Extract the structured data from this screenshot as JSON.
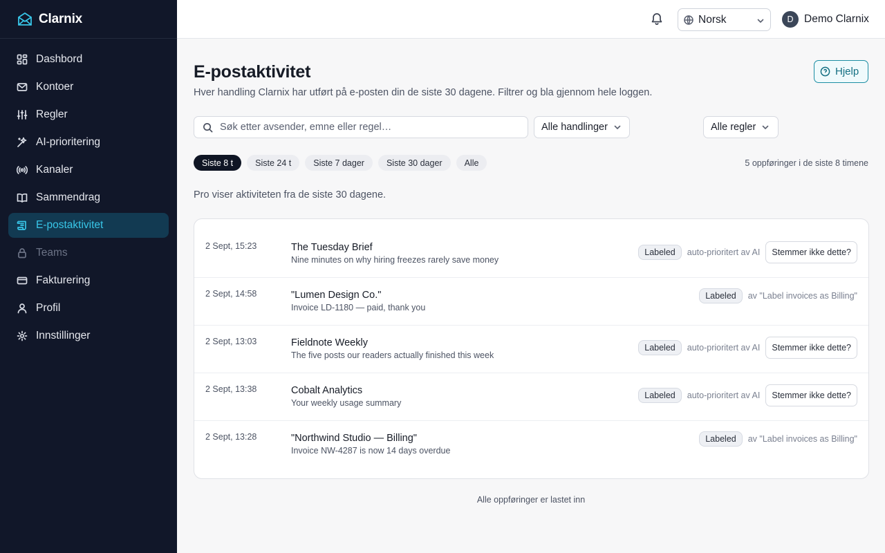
{
  "app": {
    "name": "Clarnix"
  },
  "sidebar": {
    "items": [
      {
        "label": "Dashbord",
        "icon": "grid-icon"
      },
      {
        "label": "Kontoer",
        "icon": "mail-icon"
      },
      {
        "label": "Regler",
        "icon": "sliders-icon"
      },
      {
        "label": "AI-prioritering",
        "icon": "sparkle-icon"
      },
      {
        "label": "Kanaler",
        "icon": "broadcast-icon"
      },
      {
        "label": "Sammendrag",
        "icon": "book-icon"
      },
      {
        "label": "E-postaktivitet",
        "icon": "scroll-icon",
        "active": true
      },
      {
        "label": "Teams",
        "icon": "lock-icon",
        "disabled": true
      },
      {
        "label": "Fakturering",
        "icon": "card-icon"
      },
      {
        "label": "Profil",
        "icon": "user-icon"
      },
      {
        "label": "Innstillinger",
        "icon": "gear-icon"
      }
    ]
  },
  "topbar": {
    "language": "Norsk",
    "user_initial": "D",
    "user_name": "Demo Clarnix"
  },
  "page": {
    "title": "E-postaktivitet",
    "subtitle": "Hver handling Clarnix har utført på e-posten din de siste 30 dagene. Filtrer og bla gjennom hele loggen.",
    "help_label": "Hjelp",
    "search_placeholder": "Søk etter avsender, emne eller regel…",
    "actions_filter": "Alle handlinger",
    "rules_filter": "Alle regler",
    "time_chips": [
      "Siste 8 t",
      "Siste 24 t",
      "Siste 7 dager",
      "Siste 30 dager",
      "Alle"
    ],
    "active_chip": 0,
    "entries_count": "5 oppføringer i de siste 8 timene",
    "pro_note": "Pro viser aktiviteten fra de siste 30 dagene.",
    "all_loaded": "Alle oppføringer er lastet inn"
  },
  "log": [
    {
      "time": "2 Sept, 15:23",
      "sender": "The Tuesday Brief",
      "subject": "Nine minutes on why hiring freezes rarely save money",
      "badge": "Labeled",
      "reason": "auto-prioritert av AI",
      "dispute": "Stemmer ikke dette?"
    },
    {
      "time": "2 Sept, 14:58",
      "sender": "\"Lumen Design Co.\"",
      "subject": "Invoice LD-1180 — paid, thank you",
      "badge": "Labeled",
      "reason": "av \"Label invoices as Billing\"",
      "dispute": ""
    },
    {
      "time": "2 Sept, 13:03",
      "sender": "Fieldnote Weekly",
      "subject": "The five posts our readers actually finished this week",
      "badge": "Labeled",
      "reason": "auto-prioritert av AI",
      "dispute": "Stemmer ikke dette?"
    },
    {
      "time": "2 Sept, 13:38",
      "sender": "Cobalt Analytics",
      "subject": "Your weekly usage summary",
      "badge": "Labeled",
      "reason": "auto-prioritert av AI",
      "dispute": "Stemmer ikke dette?"
    },
    {
      "time": "2 Sept, 13:28",
      "sender": "\"Northwind Studio — Billing\"",
      "subject": "Invoice NW-4287 is now 14 days overdue",
      "badge": "Labeled",
      "reason": "av \"Label invoices as Billing\"",
      "dispute": ""
    }
  ],
  "colors": {
    "sidebar_bg": "#111729",
    "accent": "#38c6e8",
    "active_bg": "#123a52",
    "help_border": "#1a8da3"
  }
}
